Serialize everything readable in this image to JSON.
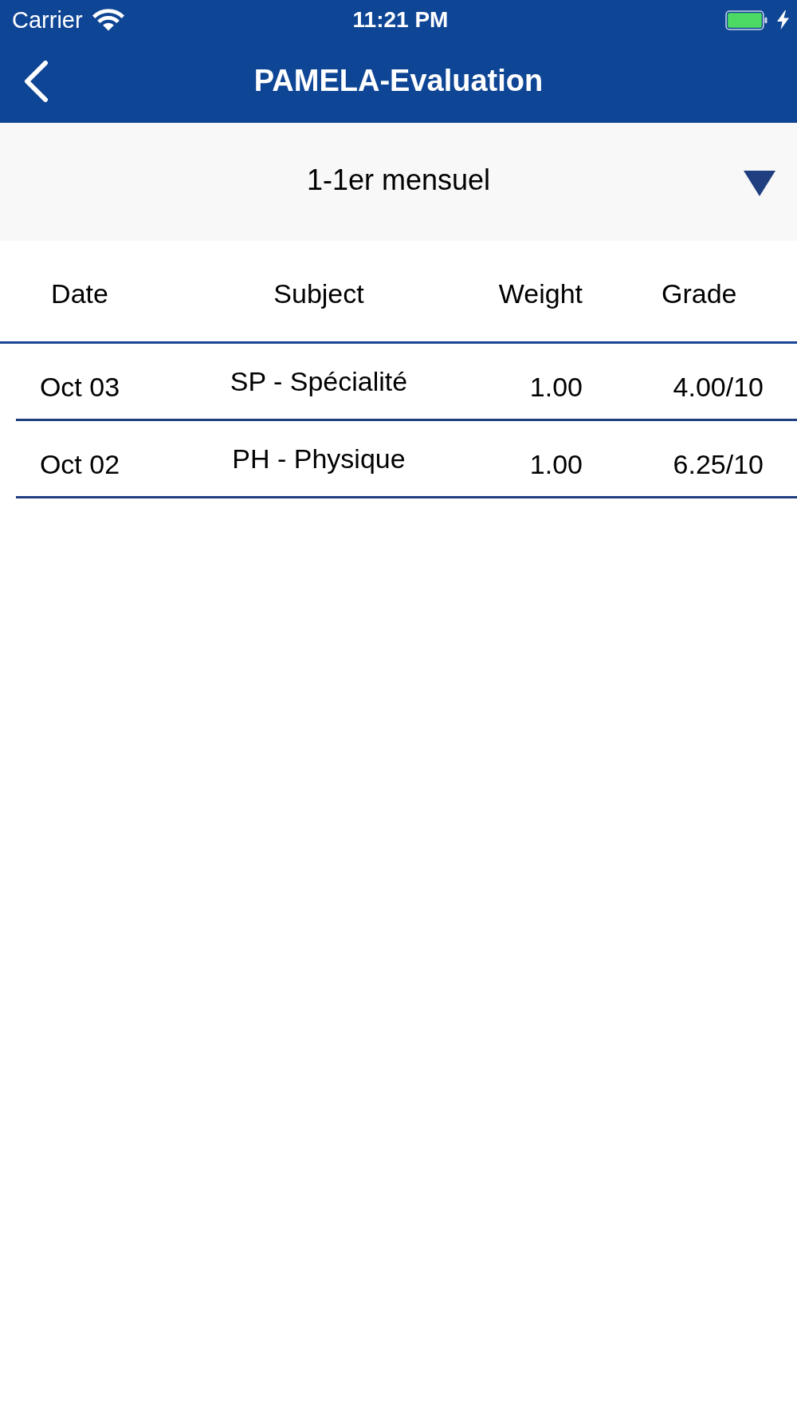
{
  "status_bar": {
    "carrier": "Carrier",
    "time": "11:21 PM"
  },
  "nav_bar": {
    "title": "PAMELA-Evaluation"
  },
  "period_selector": {
    "value": "1-1er mensuel"
  },
  "table": {
    "columns": [
      "Date",
      "Subject",
      "Weight",
      "Grade"
    ],
    "rows": [
      [
        "Oct 03",
        "SP - Spécialité",
        "1.00",
        "4.00/10"
      ],
      [
        "Oct 02",
        "PH - Physique",
        "1.00",
        "6.25/10"
      ]
    ]
  }
}
